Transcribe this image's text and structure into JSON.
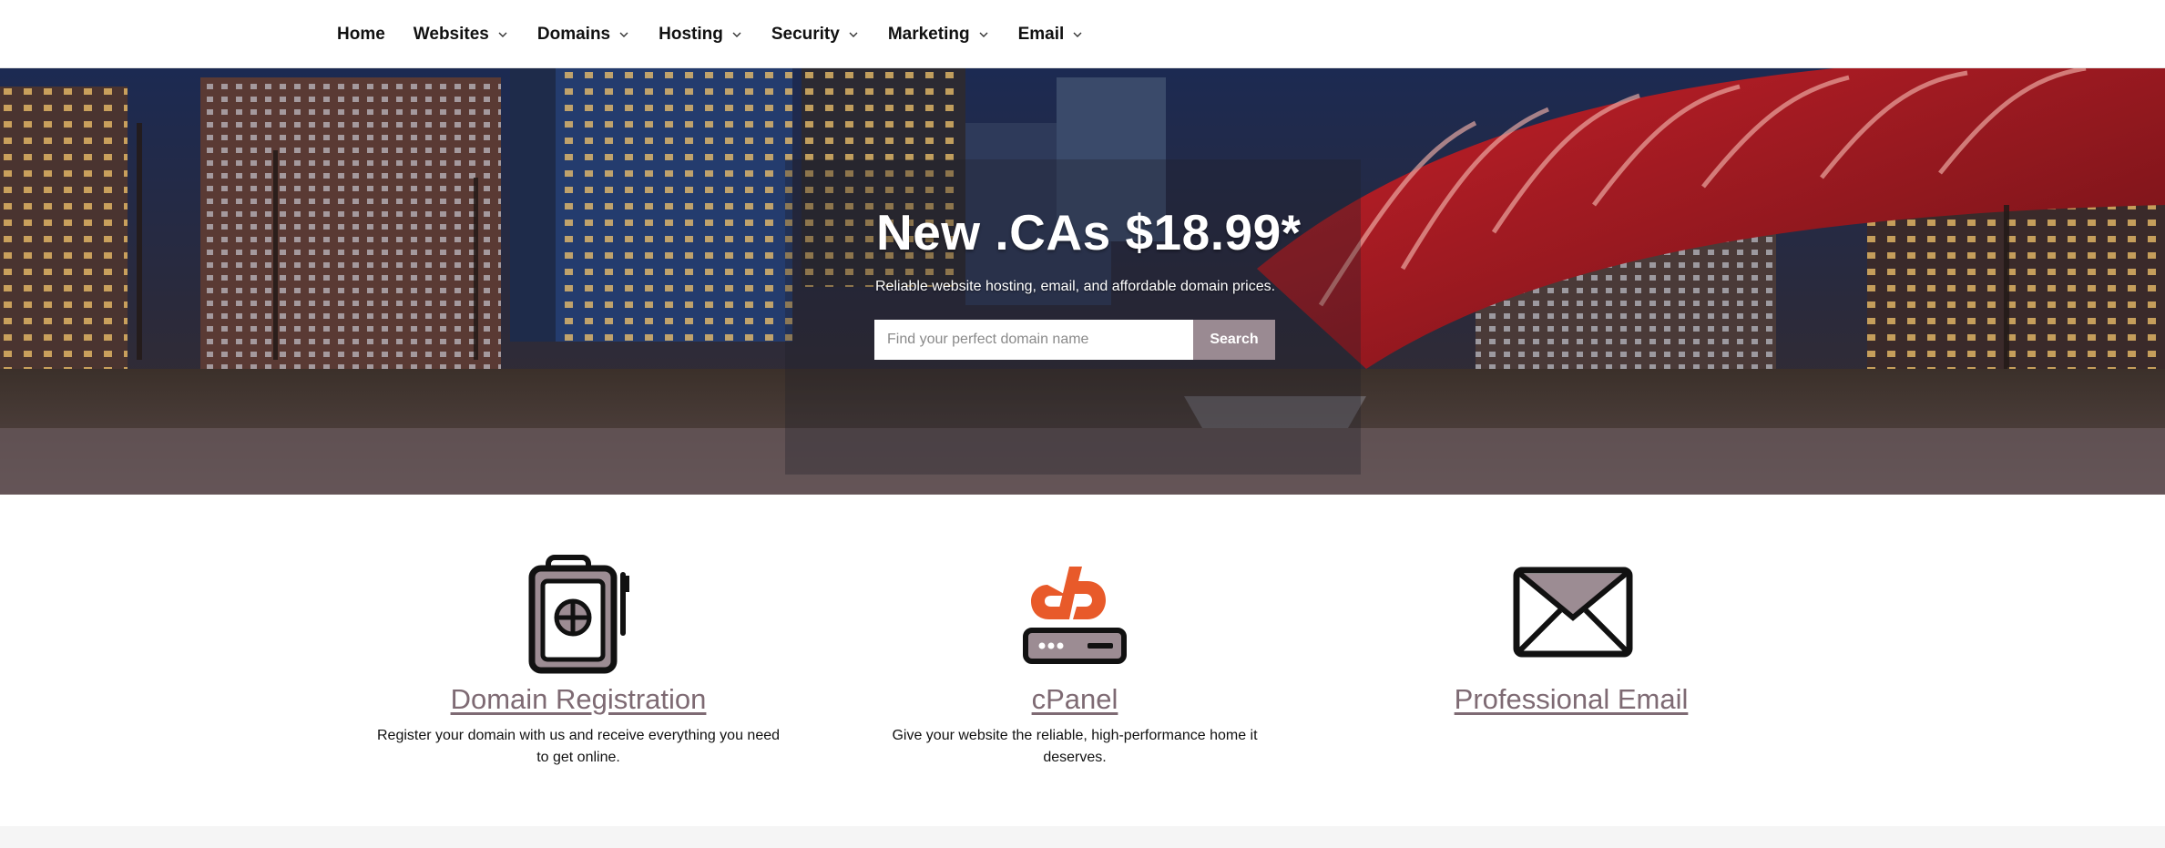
{
  "nav": {
    "items": [
      {
        "label": "Home",
        "has_dropdown": false
      },
      {
        "label": "Websites",
        "has_dropdown": true
      },
      {
        "label": "Domains",
        "has_dropdown": true
      },
      {
        "label": "Hosting",
        "has_dropdown": true
      },
      {
        "label": "Security",
        "has_dropdown": true
      },
      {
        "label": "Marketing",
        "has_dropdown": true
      },
      {
        "label": "Email",
        "has_dropdown": true
      }
    ]
  },
  "hero": {
    "title": "New .CAs $18.99*",
    "subtitle": "Reliable website hosting, email, and affordable domain prices.",
    "search": {
      "placeholder": "Find your perfect domain name",
      "value": "",
      "button_label": "Search"
    },
    "background": "night-city-skyline-with-red-bridge"
  },
  "features": [
    {
      "icon": "passport-icon",
      "title": "Domain Registration",
      "description_lines": [
        "Register your domain with us and receive everything you need",
        "to get online."
      ]
    },
    {
      "icon": "cpanel-server-icon",
      "title": "cPanel",
      "description_lines": [
        "Give your website the reliable, high-performance home it",
        "deserves."
      ]
    },
    {
      "icon": "envelope-icon",
      "title": "Professional Email",
      "description_lines": []
    }
  ],
  "colors": {
    "accent": "#7e6a73",
    "search_button": "#9a8a92",
    "cpanel_orange": "#e85a2a",
    "icon_fill": "#9c8c93"
  }
}
